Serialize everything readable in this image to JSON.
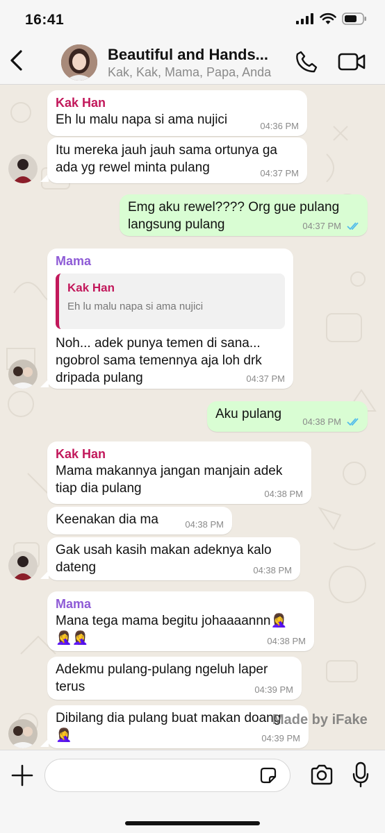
{
  "status": {
    "time": "16:41"
  },
  "header": {
    "title": "Beautiful and Hands...",
    "subtitle": "Kak, Kak, Mama, Papa, Anda"
  },
  "messages": [
    {
      "sender": "Kak Han",
      "text": "Eh lu malu napa si ama nujici",
      "time": "04:36 PM"
    },
    {
      "text": "Itu mereka jauh jauh sama ortunya ga\nada yg rewel minta pulang",
      "time": "04:37 PM"
    },
    {
      "text": "Emg aku rewel???? Org gue pulang\nlangsung pulang",
      "time": "04:37 PM"
    },
    {
      "sender": "Mama",
      "quote_name": "Kak Han",
      "quote_text": "Eh lu malu napa si ama nujici",
      "text": "Noh... adek punya temen di sana...\nngobrol sama temennya aja loh drk\ndripada pulang",
      "time": "04:37 PM"
    },
    {
      "text": "Aku pulang",
      "time": "04:38 PM"
    },
    {
      "sender": "Kak Han",
      "text": "Mama makannya jangan manjain adek\ntiap dia pulang",
      "time": "04:38 PM"
    },
    {
      "text": "Keenakan dia ma",
      "time": "04:38 PM"
    },
    {
      "text": "Gak usah kasih makan adeknya kalo\ndateng",
      "time": "04:38 PM"
    },
    {
      "sender": "Mama",
      "text": "Mana tega mama begitu johaaaannn🤦‍♀️\n🤦‍♀️🤦‍♀️",
      "time": "04:38 PM"
    },
    {
      "text": "Adekmu pulang-pulang ngeluh laper\nterus",
      "time": "04:39 PM"
    },
    {
      "text": "Dibilang dia pulang buat makan doang\n🤦‍♀️",
      "time": "04:39 PM"
    }
  ],
  "watermark": "Made by iFake",
  "composer": {
    "placeholder": ""
  },
  "colors": {
    "outgoing": "#d9fdd3",
    "incoming": "#ffffff",
    "kak_han": "#c2185b",
    "mama": "#8e5bd6",
    "read_ticks": "#53bdeb"
  }
}
